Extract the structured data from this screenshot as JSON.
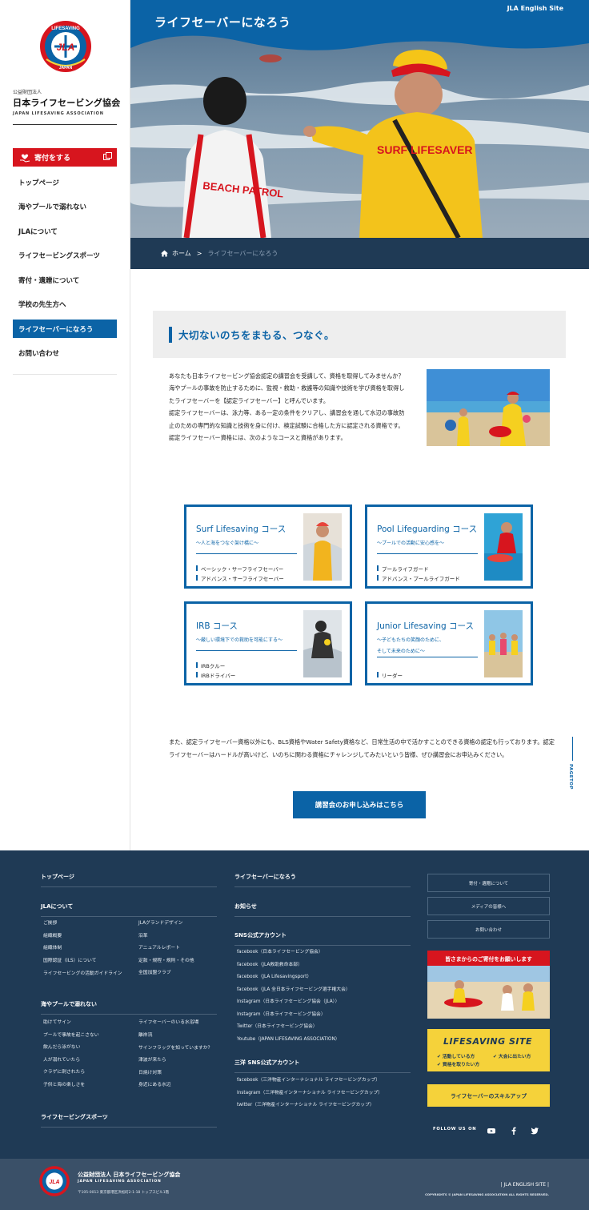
{
  "sidebar": {
    "logo_alt": "LIFESAVING JAPAN",
    "org_sub": "公益財団法人",
    "org_name": "日本ライフセービング協会",
    "org_en": "JAPAN LIFESAVING ASSOCIATION",
    "donate_label": "寄付をする",
    "nav": [
      {
        "label": "トップページ"
      },
      {
        "label": "海やプールで溺れない"
      },
      {
        "label": "JLAについて"
      },
      {
        "label": "ライフセービングスポーツ"
      },
      {
        "label": "寄付・遺贈について"
      },
      {
        "label": "学校の先生方へ"
      },
      {
        "label": "ライフセーバーになろう",
        "active": true
      },
      {
        "label": "お問い合わせ"
      }
    ]
  },
  "hero": {
    "title": "ライフセーバーになろう",
    "english_link": "JLA English Site",
    "jacket_left": "BEACH PATROL",
    "jacket_right": "SURF LIFESAVER"
  },
  "breadcrumb": {
    "home": "ホーム",
    "separator": ">",
    "current": "ライフセーバーになろう"
  },
  "main": {
    "heading": "大切ないのちをまもる、つなぐ。",
    "intro_paragraphs": [
      "あなたも日本ライフセービング協会認定の講習会を受講して、資格を取得してみませんか？",
      "海やプールの事故を防止するために、監視・救助・救護等の知識や技術を学び資格を取得したライフセーバーを【認定ライフセーバー】と呼んでいます。",
      "認定ライフセーバーは、泳力等、ある一定の条件をクリアし、講習会を通して水辺の事故防止のための専門的な知識と技術を身に付け、検定試験に合格した方に認定される資格です。認定ライフセーバー資格には、次のようなコースと資格があります。"
    ],
    "courses": [
      {
        "title": "Surf Lifesaving コース",
        "subtitle": "〜人と海をつなぐ架け橋に〜",
        "items": [
          "ベーシック・サーフライフセーバー",
          "アドバンス・サーフライフセーバー"
        ]
      },
      {
        "title": "Pool Lifeguarding コース",
        "subtitle": "〜プールでの活動に安心感を〜",
        "items": [
          "プールライフガード",
          "アドバンス・プールライフガード"
        ]
      },
      {
        "title": "IRB コース",
        "subtitle": "〜厳しい環境下での救助を可能にする〜",
        "items": [
          "IRBクルー",
          "IRBドライバー"
        ]
      },
      {
        "title": "Junior Lifesaving コース",
        "subtitle": "〜子どもたちの笑顔のために、",
        "subtitle2": "そして未来のために〜",
        "items": [
          "リーダー"
        ]
      }
    ],
    "outro": "また、認定ライフセーバー資格以外にも、BLS資格やWater Safety資格など、日常生活の中で活かすことのできる資格の認定も行っております。認定ライフセーバーはハードルが高いけど、いのちに関わる資格にチャレンジしてみたいという皆様、ぜひ講習会にお申込みください。",
    "apply_label": "講習会のお申し込みはこちら",
    "pagetop": "PAGETOP"
  },
  "footer": {
    "col1": {
      "top": "トップページ",
      "jla_head": "JLAについて",
      "jla_left": [
        "ご挨拶",
        "組織概要",
        "組織体制",
        "国際認証（ILS）について",
        "ライフセービングの活動ガイドライン"
      ],
      "jla_right": [
        "JLAグランドデザイン",
        "沿革",
        "アニュアルレポート",
        "定款・規程・規則・その他",
        "全国加盟クラブ"
      ],
      "sea_head": "海やプールで溺れない",
      "sea_left": [
        "助けてサイン",
        "プールで事故を起こさない",
        "飲んだら泳がない",
        "人が溺れていたら",
        "クラゲに刺されたら",
        "子供と海の楽しさを"
      ],
      "sea_right": [
        "ライフセーバーのいる水浴場",
        "離岸流",
        "サインフラッグを知っていますか？",
        "津波が来たら",
        "日焼け対策",
        "身近にある水辺"
      ],
      "sports_head": "ライフセービングスポーツ"
    },
    "col2": {
      "become": "ライフセーバーになろう",
      "news": "お知らせ",
      "sns_head": "SNS公式アカウント",
      "sns": [
        "facebook（日本ライフセービング協会）",
        "facebook（JLA救助救命本部）",
        "facebook（JLA Lifesavingsport）",
        "facebook（JLA 全日本ライフセービング選手権大会）",
        "Instagram（日本ライフセービング協会（JLA））",
        "Instagram（日本ライフセービング協会）",
        "Twitter（日本ライフセービング協会）",
        "Youtube（JAPAN LIFESAVING ASSOCIATION）"
      ],
      "sanyo_head": "三洋 SNS公式アカウント",
      "sanyo": [
        "facebook（三洋物産インターナショナル ライフセービングカップ）",
        "Instagram（三洋物産インターナショナル ライフセービングカップ）",
        "twitter（三洋物産インターナショナル ライフセービングカップ）"
      ]
    },
    "col3": {
      "buttons": [
        "寄付・遺贈について",
        "メディアの皆様へ",
        "お問い合わせ"
      ],
      "donate_banner": "皆さまからのご寄付をお願いします",
      "lifesaving_site": "LIFESAVING SITE",
      "ls_items": [
        "活動している方",
        "大会に出たい方",
        "資格を取りたい方"
      ],
      "skill_up": "ライフセーバーのスキルアップ",
      "follow": "FOLLOW US ON"
    },
    "bottom": {
      "org": "公益財団法人 日本ライフセービング協会",
      "org_en": "JAPAN LIFESAVING ASSOCIATION",
      "address": "〒105-0013 東京都港区浜松町2-1-18 トップスビル1階",
      "english_site": "| JLA ENGLISH SITE |",
      "copyright": "COPYRIGHTS © JAPAN LIFESAVING ASSOCIATION ALL RIGHTS RESERVED."
    }
  },
  "colors": {
    "brand_blue": "#0b63a6",
    "navy": "#1f3a55",
    "red": "#d7151e",
    "yellow": "#f5d23a"
  }
}
